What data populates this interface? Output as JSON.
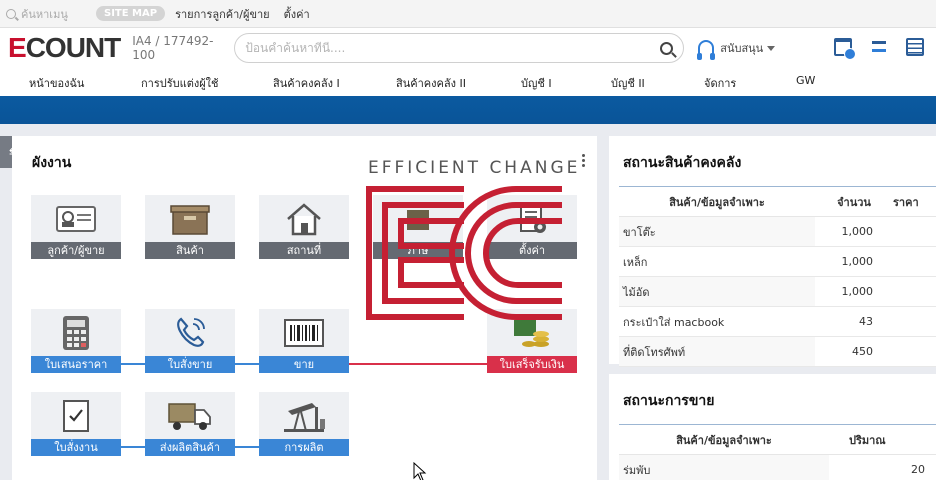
{
  "topbar": {
    "search_placeholder": "ค้นหาเมนู",
    "sitemap": "SITE MAP",
    "links": [
      "รายการลูกค้า/ผู้ขาย",
      "ตั้งค่า"
    ]
  },
  "header": {
    "logo_text": "COUNT",
    "logo_mark": "E",
    "company_id": "IA4 / 177492-100",
    "search_placeholder": "ป้อนคำค้นหาที่นี่....",
    "support_label": "สนับสนุน"
  },
  "nav": {
    "items": [
      "หน้าของฉัน",
      "การปรับแต่งผู้ใช้",
      "สินค้าคงคลัง I",
      "สินค้าคงคลัง II",
      "บัญชี I",
      "บัญชี II",
      "จัดการ",
      "GW"
    ]
  },
  "workflow": {
    "title": "ผังงาน",
    "tiles": [
      {
        "label": "ลูกค้า/ผู้ขาย",
        "icon": "id-card-icon"
      },
      {
        "label": "สินค้า",
        "icon": "box-icon"
      },
      {
        "label": "สถานที่",
        "icon": "house-icon"
      },
      {
        "label": "ภาษี",
        "icon": "tax-icon"
      },
      {
        "label": "ตั้งค่า",
        "icon": "settings-doc-icon"
      },
      {
        "label": "ใบเสนอราคา",
        "icon": "calculator-icon"
      },
      {
        "label": "ใบสั่งขาย",
        "icon": "phone-icon"
      },
      {
        "label": "ขาย",
        "icon": "barcode-icon"
      },
      {
        "label": "ใบเสร็จรับเงิน",
        "icon": "money-icon"
      },
      {
        "label": "ใบสั่งงาน",
        "icon": "checklist-icon"
      },
      {
        "label": "ส่งผลิตสินค้า",
        "icon": "truck-icon"
      },
      {
        "label": "การผลิต",
        "icon": "oil-pump-icon"
      }
    ]
  },
  "watermark": {
    "tagline": "EFFICIENT CHANGE"
  },
  "inventory": {
    "title": "สถานะสินค้าคงคลัง",
    "columns": [
      "สินค้า/ข้อมูลจำเพาะ",
      "จำนวน",
      "ราคา"
    ],
    "rows": [
      {
        "name": "ขาโต๊ะ",
        "qty": "1,000"
      },
      {
        "name": "เหล็ก",
        "qty": "1,000"
      },
      {
        "name": "ไม้อัด",
        "qty": "1,000"
      },
      {
        "name": "กระเป๋าใส่ macbook",
        "qty": "43"
      },
      {
        "name": "ที่ติดโทรศัพท์",
        "qty": "450"
      }
    ]
  },
  "sales": {
    "title": "สถานะการขาย",
    "columns": [
      "สินค้า/ข้อมูลจำเพาะ",
      "ปริมาณ"
    ],
    "rows": [
      {
        "name": "ร่มพับ",
        "qty": "20"
      }
    ]
  },
  "colors": {
    "brand_red": "#c8102e",
    "nav_blue": "#0b5aa0",
    "tile_blue": "#3a86d6",
    "tile_red": "#d9304a"
  }
}
